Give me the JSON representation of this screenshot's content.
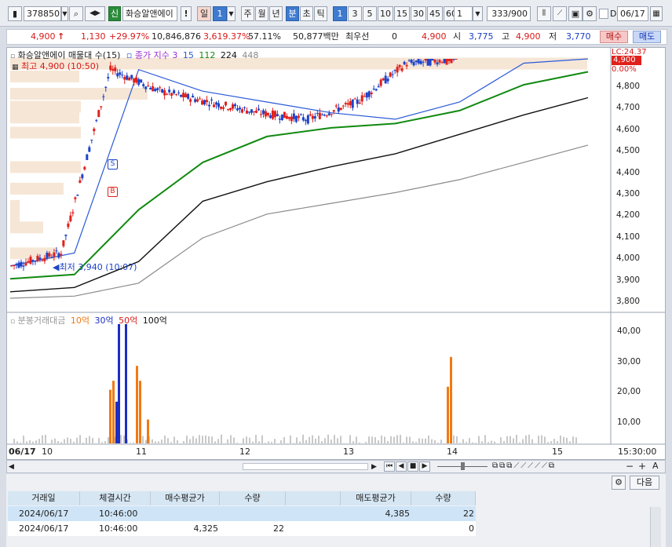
{
  "toolbar": {
    "code": "378850",
    "stock_name": "화승알앤에이",
    "shin": "신",
    "excl": "!",
    "period_day": "일",
    "period_count": "1",
    "period_week": "주",
    "period_month": "월",
    "period_year": "년",
    "period_min": "분",
    "period_sec": "초",
    "period_tick": "틱",
    "intervals": [
      "1",
      "3",
      "5",
      "10",
      "15",
      "30",
      "45",
      "60"
    ],
    "interval_select": "1",
    "count_display": "333/900",
    "d_label": "D",
    "date": "06/17"
  },
  "quote": {
    "price": "4,900",
    "arrow": "↑",
    "change": "1,130",
    "change_pct": "+29.97%",
    "volume": "10,846,876",
    "vol_pct": "3,619.37%",
    "turnover_pct": "57.11%",
    "amount": "50,877백만",
    "pref_label": "최우선",
    "pref_value": "0",
    "best_price": "4,900",
    "open_label": "시",
    "open": "3,775",
    "high_label": "고",
    "high": "4,900",
    "low_label": "저",
    "low": "3,770",
    "buy_btn": "매수",
    "sell_btn": "매도"
  },
  "chart": {
    "title_stock": "화승알앤에이 매물대 수(15)",
    "title_ma": "종가 지수 3",
    "ma_15": "15",
    "ma_112": "112",
    "ma_224": "224",
    "ma_448": "448",
    "high_note": "최고 4,900 (10:50)",
    "low_note": "최저 3,940 (10:07)",
    "lc_label": "LC:24.37",
    "price_tag": "4,900",
    "pct_tag": "0.00%",
    "sell_marker": "S",
    "buy_marker": "B",
    "price_axis": [
      "4,800",
      "4,700",
      "4,600",
      "4,500",
      "4,400",
      "4,300",
      "4,200",
      "4,100",
      "4,000",
      "3,900",
      "3,800"
    ],
    "vol_title": "분봉거래대금",
    "vol_legend": [
      "10억",
      "30억",
      "50억",
      "100억"
    ],
    "vol_axis": [
      "40,00",
      "30,00",
      "20,00",
      "10,00"
    ],
    "date_label": "06/17",
    "time_labels": [
      "10",
      "11",
      "12",
      "13",
      "14",
      "15"
    ],
    "end_time": "15:30:00",
    "colors": {
      "up": "#e0201b",
      "down": "#1d43c9",
      "ma3": "#2a5ad8",
      "ma112": "#118a11",
      "ma224": "#111111",
      "ma448": "#8a8a8a",
      "vol10": "#f07a12",
      "vol30": "#1c2fc4",
      "vol50": "#d81b1b"
    }
  },
  "chart_data": {
    "type": "candlestick",
    "title": "화승알앤에이 매물대 수(15)",
    "x": [
      "10",
      "11",
      "12",
      "13",
      "14",
      "15"
    ],
    "ylim": [
      3750,
      4900
    ],
    "series": [
      {
        "name": "종가 지수 3",
        "values": [
          3940,
          4000,
          4850,
          4750,
          4700,
          4650,
          4620,
          4700,
          4880,
          4900
        ]
      },
      {
        "name": "112",
        "values": [
          3880,
          3900,
          4200,
          4420,
          4540,
          4580,
          4600,
          4660,
          4780,
          4840
        ]
      },
      {
        "name": "224",
        "values": [
          3820,
          3840,
          3960,
          4240,
          4330,
          4400,
          4460,
          4550,
          4640,
          4720
        ]
      },
      {
        "name": "448",
        "values": [
          3790,
          3800,
          3860,
          4070,
          4180,
          4230,
          4280,
          4340,
          4420,
          4500
        ]
      }
    ],
    "volume": {
      "peak_left": 40.0,
      "peak_right": 29.0,
      "ylim": [
        0,
        40
      ]
    }
  },
  "scrollbar": {
    "icons": [
      "first-icon",
      "prev-icon",
      "stop-icon",
      "next-icon"
    ],
    "right_icons": [
      "minus-icon",
      "plus-icon",
      "a-label"
    ],
    "a_label": "A"
  },
  "table": {
    "next_btn": "다음",
    "headers": [
      "거래일",
      "체결시간",
      "매수평균가",
      "수량",
      "",
      "매도평균가",
      "수량"
    ],
    "rows": [
      [
        "2024/06/17",
        "10:46:00",
        "",
        "",
        "",
        "4,385",
        "22"
      ],
      [
        "2024/06/17",
        "10:46:00",
        "4,325",
        "22",
        "",
        "",
        "0"
      ]
    ]
  }
}
